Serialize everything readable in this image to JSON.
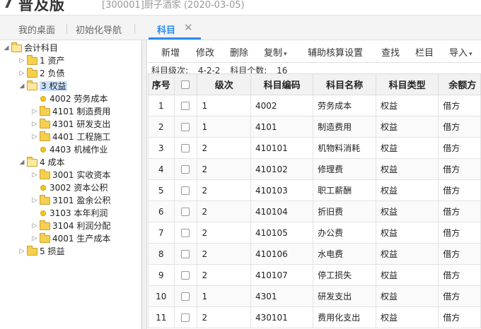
{
  "header": {
    "logo_glyph": "7",
    "title": "普及版",
    "subtitle": "[300001]厨子酒家 (2020-03-05)"
  },
  "tabs": [
    {
      "label": "我的桌面"
    },
    {
      "label": "初始化导航"
    },
    {
      "label": "科目",
      "active": true,
      "close": "✕"
    }
  ],
  "tree": {
    "nodes": [
      {
        "label": "会计科目",
        "icon": "folder-open-icon",
        "toggle": "◢",
        "level": 0
      },
      {
        "label": "1 资产",
        "icon": "folder-icon",
        "toggle": "▷",
        "level": 1
      },
      {
        "label": "2 负债",
        "icon": "folder-icon",
        "toggle": "▷",
        "level": 1
      },
      {
        "label": "3 权益",
        "icon": "folder-open-icon",
        "toggle": "◢",
        "level": 1,
        "selected": true
      },
      {
        "label": "4002 劳务成本",
        "icon": "leaf-icon",
        "toggle": "",
        "level": 2
      },
      {
        "label": "4101 制造费用",
        "icon": "folder-icon",
        "toggle": "▷",
        "level": 2
      },
      {
        "label": "4301 研发支出",
        "icon": "folder-icon",
        "toggle": "▷",
        "level": 2
      },
      {
        "label": "4401 工程施工",
        "icon": "folder-icon",
        "toggle": "▷",
        "level": 2
      },
      {
        "label": "4403 机械作业",
        "icon": "leaf-icon",
        "toggle": "",
        "level": 2
      },
      {
        "label": "4 成本",
        "icon": "folder-open-icon",
        "toggle": "◢",
        "level": 1
      },
      {
        "label": "3001 实收资本",
        "icon": "folder-icon",
        "toggle": "▷",
        "level": 2
      },
      {
        "label": "3002 资本公积",
        "icon": "leaf-icon",
        "toggle": "",
        "level": 2
      },
      {
        "label": "3101 盈余公积",
        "icon": "folder-icon",
        "toggle": "▷",
        "level": 2
      },
      {
        "label": "3103 本年利润",
        "icon": "leaf-icon",
        "toggle": "",
        "level": 2
      },
      {
        "label": "3104 利润分配",
        "icon": "folder-icon",
        "toggle": "▷",
        "level": 2
      },
      {
        "label": "4001 生产成本",
        "icon": "folder-icon",
        "toggle": "▷",
        "level": 2
      },
      {
        "label": "5 损益",
        "icon": "folder-icon",
        "toggle": "▷",
        "level": 1
      }
    ]
  },
  "toolbar": {
    "add": "新增",
    "edit": "修改",
    "delete": "删除",
    "copy": "复制",
    "aux_setup": "辅助核算设置",
    "find": "查找",
    "columns": "栏目",
    "import": "导入",
    "caret": "▾"
  },
  "info": {
    "level_label": "科目级次:",
    "level_value": "4-2-2",
    "count_label": "科目个数:",
    "count_value": "16"
  },
  "table": {
    "headers": [
      "序号",
      "",
      "级次",
      "科目编码",
      "科目名称",
      "科目类型",
      "余额方"
    ],
    "rows": [
      {
        "idx": "1",
        "level": "1",
        "code": "4002",
        "name": "劳务成本",
        "type": "权益",
        "dir": "借方",
        "indent": false
      },
      {
        "idx": "2",
        "level": "1",
        "code": "4101",
        "name": "制造费用",
        "type": "权益",
        "dir": "借方",
        "indent": false
      },
      {
        "idx": "3",
        "level": "2",
        "code": "410101",
        "name": "机物料消耗",
        "type": "权益",
        "dir": "借方",
        "indent": true
      },
      {
        "idx": "4",
        "level": "2",
        "code": "410102",
        "name": "修理费",
        "type": "权益",
        "dir": "借方",
        "indent": true
      },
      {
        "idx": "5",
        "level": "2",
        "code": "410103",
        "name": "职工薪酬",
        "type": "权益",
        "dir": "借方",
        "indent": true
      },
      {
        "idx": "6",
        "level": "2",
        "code": "410104",
        "name": "折旧费",
        "type": "权益",
        "dir": "借方",
        "indent": true
      },
      {
        "idx": "7",
        "level": "2",
        "code": "410105",
        "name": "办公费",
        "type": "权益",
        "dir": "借方",
        "indent": true
      },
      {
        "idx": "8",
        "level": "2",
        "code": "410106",
        "name": "水电费",
        "type": "权益",
        "dir": "借方",
        "indent": true
      },
      {
        "idx": "9",
        "level": "2",
        "code": "410107",
        "name": "停工损失",
        "type": "权益",
        "dir": "借方",
        "indent": true
      },
      {
        "idx": "10",
        "level": "1",
        "code": "4301",
        "name": "研发支出",
        "type": "权益",
        "dir": "借方",
        "indent": false
      },
      {
        "idx": "11",
        "level": "2",
        "code": "430101",
        "name": "费用化支出",
        "type": "权益",
        "dir": "借方",
        "indent": true
      }
    ]
  },
  "colors": {
    "accent": "#2d8cf0",
    "folder": "#f6cf4f"
  }
}
